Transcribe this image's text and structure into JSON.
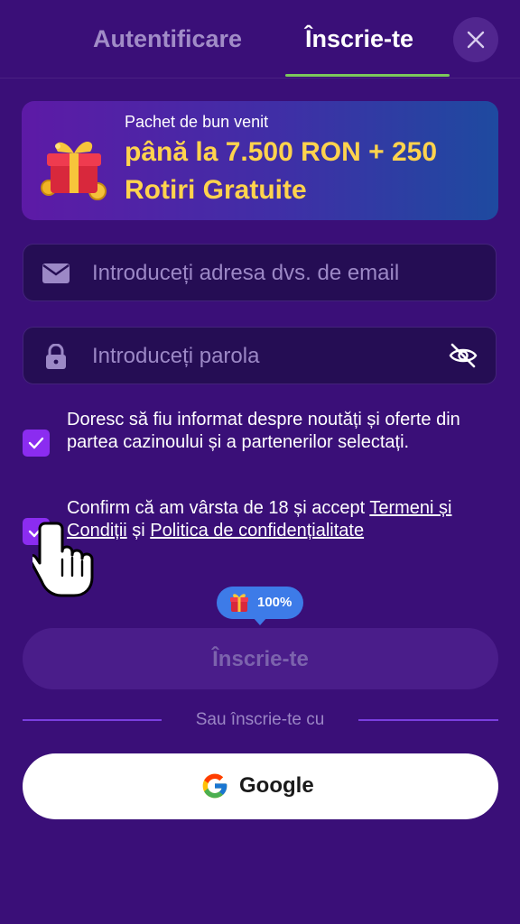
{
  "header": {
    "tab_login": "Autentificare",
    "tab_register": "Înscrie-te",
    "active_tab": "Înscrie-te",
    "close_icon": "close-icon"
  },
  "promo": {
    "kicker": "Pachet de bun venit",
    "title": "până la 7.500 RON + 250 Rotiri Gratuite",
    "icon": "gift-box-icon"
  },
  "form": {
    "email_placeholder": "Introduceți adresa dvs. de email",
    "email_value": "",
    "password_placeholder": "Introduceți parola",
    "password_value": "",
    "email_icon": "envelope-icon",
    "password_icon": "lock-icon",
    "toggle_icon": "eye-slash-icon"
  },
  "consents": {
    "newsletter_text": "Doresc să fiu informat despre noutăți și oferte din partea cazinoului și a partenerilor selectați.",
    "newsletter_checked": true,
    "age_prefix": "Confirm că am vârsta de 18 și accept ",
    "age_terms_link": "Termeni și Condiții",
    "age_middle": " și ",
    "age_privacy_link": "Politica de confidențialitate",
    "age_checked": true
  },
  "bonus_badge": {
    "percent": "100%",
    "icon": "gift-icon"
  },
  "register_button": "Înscrie-te",
  "social": {
    "divider_text": "Sau înscrie-te cu",
    "google_label": "Google",
    "google_icon": "google-logo-icon"
  },
  "colors": {
    "background": "#3a0f78",
    "accent_green": "#7cc95b",
    "checkbox": "#8b2cf0",
    "promo_yellow": "#ffd34d",
    "badge_blue": "#3d7be8"
  }
}
